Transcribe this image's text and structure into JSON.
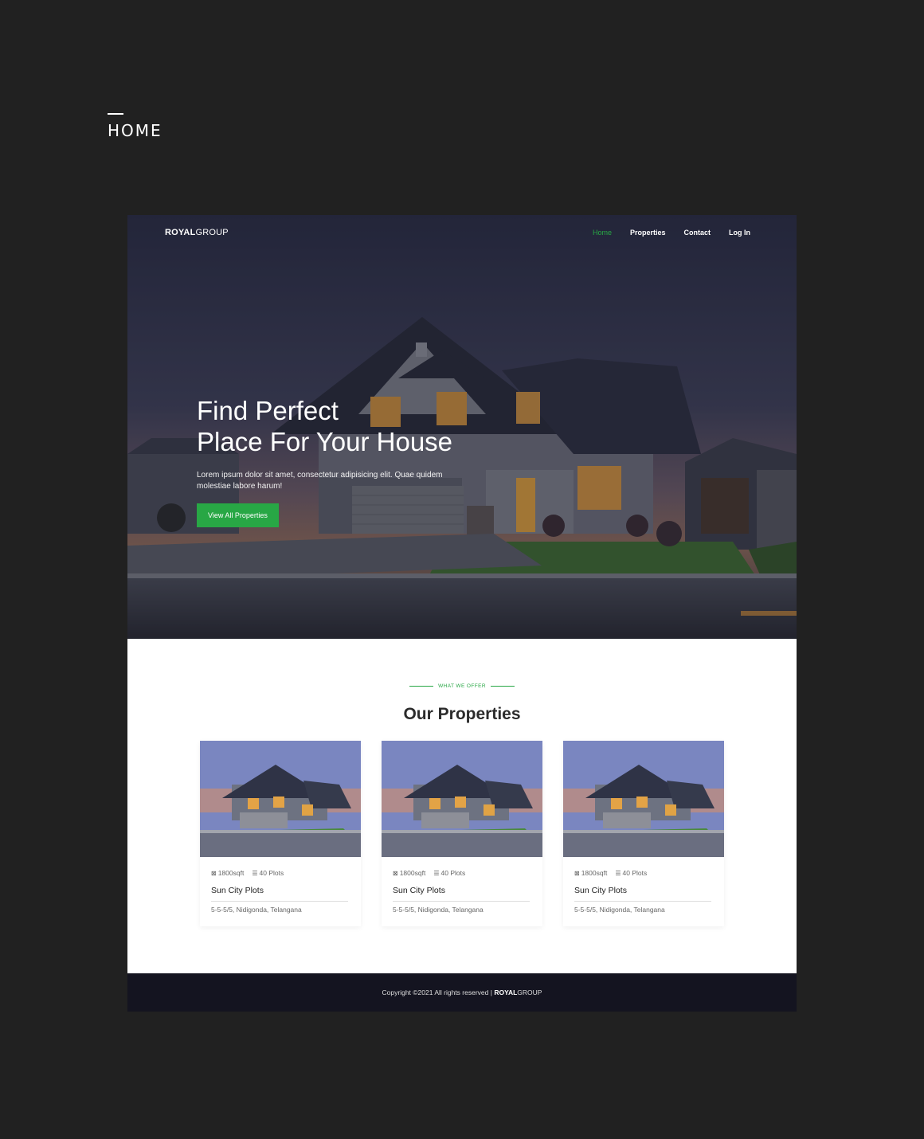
{
  "page_label": "HOME",
  "nav": {
    "logo_bold": "ROYAL",
    "logo_light": "GROUP",
    "links": [
      {
        "label": "Home",
        "active": true
      },
      {
        "label": "Properties",
        "active": false
      },
      {
        "label": "Contact",
        "active": false
      },
      {
        "label": "Log In",
        "active": false
      }
    ]
  },
  "hero": {
    "title_line1": "Find Perfect",
    "title_line2": "Place For Your House",
    "subtitle": "Lorem ipsum dolor sit amet, consectetur adipisicing elit. Quae quidem molestiae labore harum!",
    "button_label": "View All Properties"
  },
  "section": {
    "tag": "WHAT WE OFFER",
    "title": "Our Properties"
  },
  "properties": [
    {
      "area": "1800sqft",
      "plots": "40 Plots",
      "name": "Sun City Plots",
      "address": "5-5-5/5, Nidigonda, Telangana"
    },
    {
      "area": "1800sqft",
      "plots": "40 Plots",
      "name": "Sun City Plots",
      "address": "5-5-5/5, Nidigonda, Telangana"
    },
    {
      "area": "1800sqft",
      "plots": "40 Plots",
      "name": "Sun City Plots",
      "address": "5-5-5/5, Nidigonda, Telangana"
    }
  ],
  "footer": {
    "copyright": "Copyright ©2021 All rights reserved |",
    "brand_bold": "ROYAL",
    "brand_light": "GROUP"
  },
  "colors": {
    "accent": "#28a745",
    "background": "#212121",
    "footer_bg": "#141420"
  }
}
